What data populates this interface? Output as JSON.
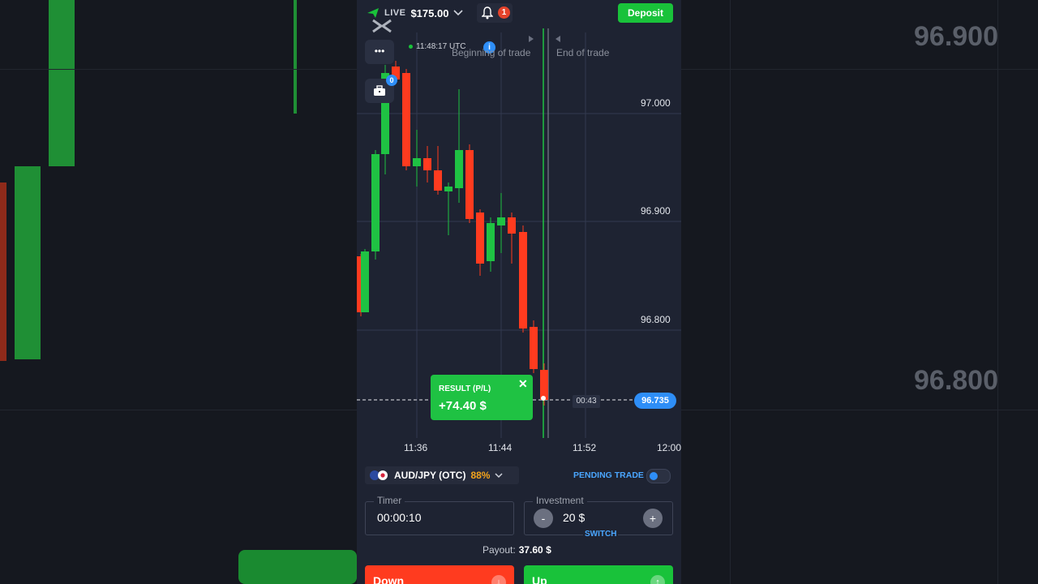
{
  "header": {
    "live_label": "LIVE",
    "balance": "$175.00",
    "notifications": "1",
    "deposit_label": "Deposit"
  },
  "toolbar": {
    "more_glyph": "•••",
    "portfolio_count": "0"
  },
  "chart": {
    "clock": "11:48:17 UTC",
    "beginning_label": "Beginning of trade",
    "end_label": "End of trade",
    "price_ticks": [
      "97.000",
      "96.900",
      "96.800"
    ],
    "time_ticks": [
      "11:36",
      "11:44",
      "11:52",
      "12:00"
    ],
    "current_price": "96.735",
    "countdown": "00:43",
    "candle_up_color": "#1fc243",
    "candle_down_color": "#ff3b1f"
  },
  "background": {
    "price_top": "96.900",
    "price_mid": "96.800"
  },
  "result": {
    "title": "RESULT (P/L)",
    "value": "+74.40 $"
  },
  "asset": {
    "name": "AUD/JPY (OTC)",
    "payout_pct": "88%"
  },
  "pending": {
    "label": "PENDING TRADE"
  },
  "timer": {
    "label": "Timer",
    "value": "00:00:10"
  },
  "investment": {
    "label": "Investment",
    "value": "20 $",
    "minus": "-",
    "plus": "+",
    "switch_label": "SWITCH"
  },
  "payout": {
    "label": "Payout:",
    "value": "37.60 $"
  },
  "actions": {
    "down_label": "Down",
    "up_label": "Up",
    "down_color": "#ff3b1f",
    "up_color": "#19c23a"
  }
}
